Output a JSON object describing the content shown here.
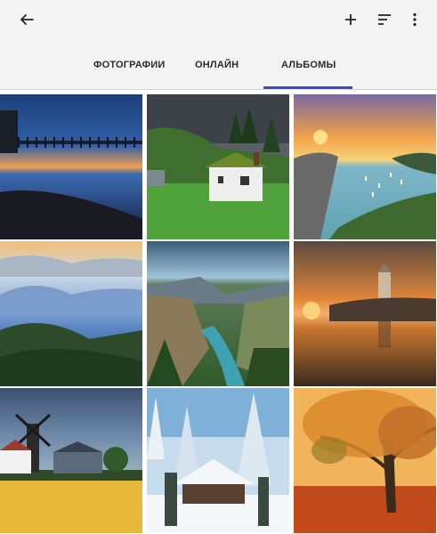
{
  "tabs": [
    {
      "label": "ФОТОГРАФИИ",
      "active": false
    },
    {
      "label": "ОНЛАЙН",
      "active": false
    },
    {
      "label": "АЛЬБОМЫ",
      "active": true
    }
  ],
  "colors": {
    "accent": "#3a4cc8",
    "appbar": "#f3f3f3"
  },
  "icons": {
    "back": "arrow-back-icon",
    "add": "add-icon",
    "sort": "sort-icon",
    "more": "more-vert-icon"
  },
  "grid": {
    "columns": 3,
    "rows": 3,
    "tile_count": 9
  }
}
